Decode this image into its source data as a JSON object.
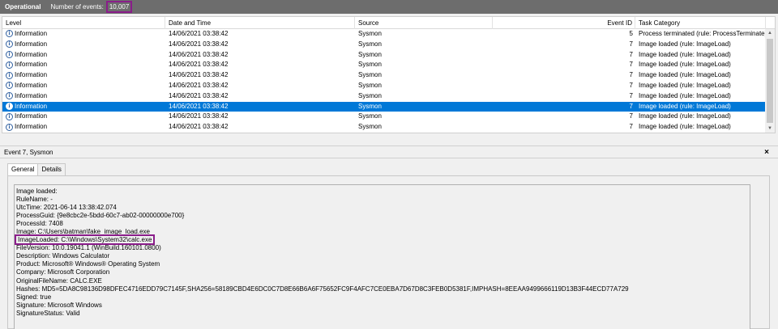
{
  "header": {
    "log_name": "Operational",
    "count_label": "Number of events:",
    "count_value": "10,007"
  },
  "columns": {
    "level": "Level",
    "date": "Date and Time",
    "source": "Source",
    "event_id": "Event ID",
    "task": "Task Category"
  },
  "rows": [
    {
      "level": "Information",
      "date": "14/06/2021 03:38:42",
      "source": "Sysmon",
      "event_id": "5",
      "task": "Process terminated (rule: ProcessTerminate)"
    },
    {
      "level": "Information",
      "date": "14/06/2021 03:38:42",
      "source": "Sysmon",
      "event_id": "7",
      "task": "Image loaded (rule: ImageLoad)"
    },
    {
      "level": "Information",
      "date": "14/06/2021 03:38:42",
      "source": "Sysmon",
      "event_id": "7",
      "task": "Image loaded (rule: ImageLoad)"
    },
    {
      "level": "Information",
      "date": "14/06/2021 03:38:42",
      "source": "Sysmon",
      "event_id": "7",
      "task": "Image loaded (rule: ImageLoad)"
    },
    {
      "level": "Information",
      "date": "14/06/2021 03:38:42",
      "source": "Sysmon",
      "event_id": "7",
      "task": "Image loaded (rule: ImageLoad)"
    },
    {
      "level": "Information",
      "date": "14/06/2021 03:38:42",
      "source": "Sysmon",
      "event_id": "7",
      "task": "Image loaded (rule: ImageLoad)"
    },
    {
      "level": "Information",
      "date": "14/06/2021 03:38:42",
      "source": "Sysmon",
      "event_id": "7",
      "task": "Image loaded (rule: ImageLoad)"
    },
    {
      "level": "Information",
      "date": "14/06/2021 03:38:42",
      "source": "Sysmon",
      "event_id": "7",
      "task": "Image loaded (rule: ImageLoad)"
    },
    {
      "level": "Information",
      "date": "14/06/2021 03:38:42",
      "source": "Sysmon",
      "event_id": "7",
      "task": "Image loaded (rule: ImageLoad)"
    },
    {
      "level": "Information",
      "date": "14/06/2021 03:38:42",
      "source": "Sysmon",
      "event_id": "7",
      "task": "Image loaded (rule: ImageLoad)"
    }
  ],
  "selected_row": 7,
  "detail": {
    "title": "Event 7, Sysmon",
    "close": "×",
    "tabs": [
      "General",
      "Details"
    ],
    "active_tab": 0,
    "lines": [
      "Image loaded:",
      "RuleName: -",
      "UtcTime: 2021-06-14 13:38:42.074",
      "ProcessGuid: {9e8cbc2e-5bdd-60c7-ab02-00000000e700}",
      "ProcessId: 7408",
      "Image: C:\\Users\\batman\\fake_image_load.exe",
      "ImageLoaded: C:\\Windows\\System32\\calc.exe",
      "FileVersion: 10.0.19041.1 (WinBuild.160101.0800)",
      "Description: Windows Calculator",
      "Product: Microsoft® Windows® Operating System",
      "Company: Microsoft Corporation",
      "OriginalFileName: CALC.EXE",
      "Hashes: MD5=5DA8C98136D98DFEC4716EDD79C7145F,SHA256=58189CBD4E6DC0C7D8E66B6A6F75652FC9F4AFC7CE0EBA7D67D8C3FEB0D5381F,IMPHASH=8EEAA9499666119D13B3F44ECD77A729",
      "Signed: true",
      "Signature: Microsoft Windows",
      "SignatureStatus: Valid"
    ],
    "highlight_line": 6
  },
  "icons": {
    "level": "information-icon",
    "scroll_up": "chevron-up-icon",
    "scroll_down": "chevron-down-icon"
  },
  "colors": {
    "selection": "#0078d7",
    "highlight_border": "#8a1d8a",
    "title_bar": "#6d6d6d"
  }
}
